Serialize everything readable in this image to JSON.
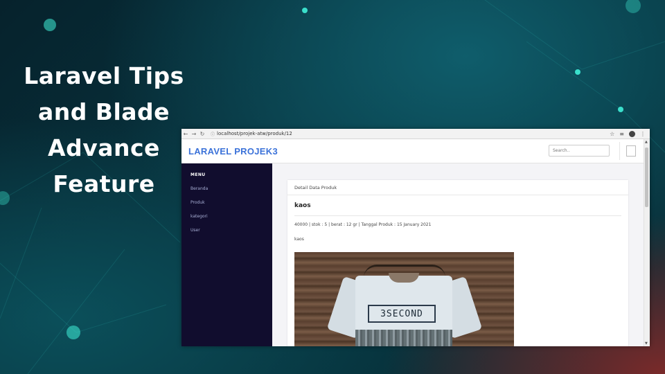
{
  "slide": {
    "title_lines": [
      "Laravel Tips",
      "and Blade",
      "Advance",
      "Feature"
    ]
  },
  "browser": {
    "url": "localhost/projek-atw/produk/12",
    "icons": [
      "back-icon",
      "forward-icon",
      "reload-icon",
      "info-icon",
      "star-icon",
      "playlist-icon",
      "profile-icon",
      "more-icon"
    ]
  },
  "app": {
    "brand": "LARAVEL PROJEK3",
    "search_placeholder": "Search..",
    "sidebar": {
      "heading": "MENU",
      "items": [
        {
          "label": "Beranda"
        },
        {
          "label": "Produk"
        },
        {
          "label": "kategori"
        },
        {
          "label": "User"
        }
      ]
    },
    "card": {
      "header": "Detail Data Produk",
      "product_name": "kaos",
      "meta": "40000 | stok : 5 | berat : 12 gr | Tanggal Produk : 15 January 2021",
      "description": "kaos",
      "image_text": "3SECOND"
    }
  },
  "colors": {
    "brand": "#3b72d9",
    "sidebar_bg": "#110d2e",
    "sidebar_text": "#a9b0d6",
    "slide_bg": "#06303a"
  }
}
